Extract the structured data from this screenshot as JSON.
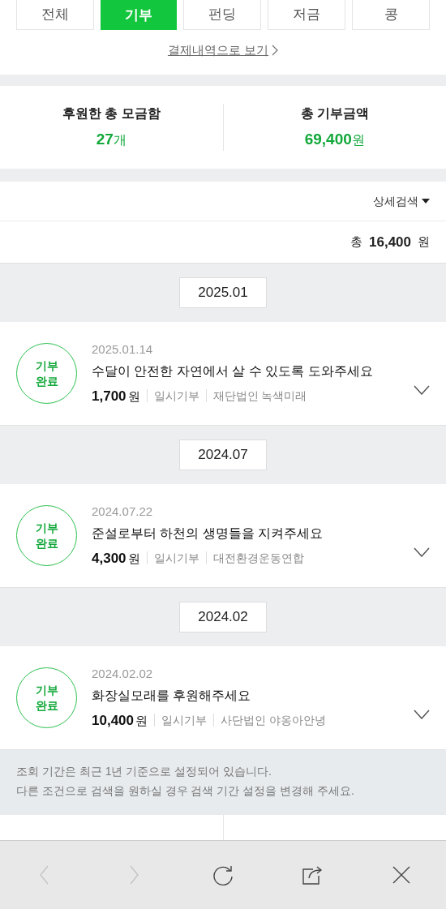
{
  "tabs": [
    {
      "label": "전체",
      "selected": false
    },
    {
      "label": "기부",
      "selected": true
    },
    {
      "label": "펀딩",
      "selected": false
    },
    {
      "label": "저금",
      "selected": false
    },
    {
      "label": "콩",
      "selected": false
    }
  ],
  "payment_link": "결제내역으로 보기",
  "summary": [
    {
      "label": "후원한 총 모금함",
      "value": "27",
      "unit": "개"
    },
    {
      "label": "총 기부금액",
      "value": "69,400",
      "unit": "원"
    }
  ],
  "filter": "상세검색",
  "total": {
    "prefix": "총",
    "amount": "16,400",
    "unit": "원"
  },
  "groups": [
    {
      "month": "2025.01",
      "items": [
        {
          "status": "기부 완료",
          "date": "2025.01.14",
          "title": "수달이 안전한 자연에서 살 수 있도록 도와주세요",
          "amount": "1,700",
          "unit": "원",
          "type": "일시기부",
          "org": "재단법인 녹색미래",
          "expanded": false
        }
      ]
    },
    {
      "month": "2024.07",
      "items": [
        {
          "status": "기부 완료",
          "date": "2024.07.22",
          "title": "준설로부터 하천의 생명들을 지켜주세요",
          "amount": "4,300",
          "unit": "원",
          "type": "일시기부",
          "org": "대전환경운동연합",
          "expanded": false
        }
      ]
    },
    {
      "month": "2024.02",
      "items": [
        {
          "status": "기부 완료",
          "date": "2024.02.02",
          "title": "화장실모래를 후원해주세요",
          "amount": "10,400",
          "unit": "원",
          "type": "일시기부",
          "org": "사단법인 야옹아안녕",
          "expanded": false
        }
      ]
    }
  ],
  "notice": [
    "조회 기간은 최근 1년 기준으로 설정되어 있습니다.",
    "다른 조건으로 검색을 원하실 경우 검색 기간 설정을 변경해 주세요."
  ],
  "toolbar": [
    {
      "kind": "back",
      "disabled": true
    },
    {
      "kind": "forward",
      "disabled": true
    },
    {
      "kind": "reload",
      "disabled": false
    },
    {
      "kind": "share",
      "disabled": false
    },
    {
      "kind": "close",
      "disabled": false
    }
  ]
}
